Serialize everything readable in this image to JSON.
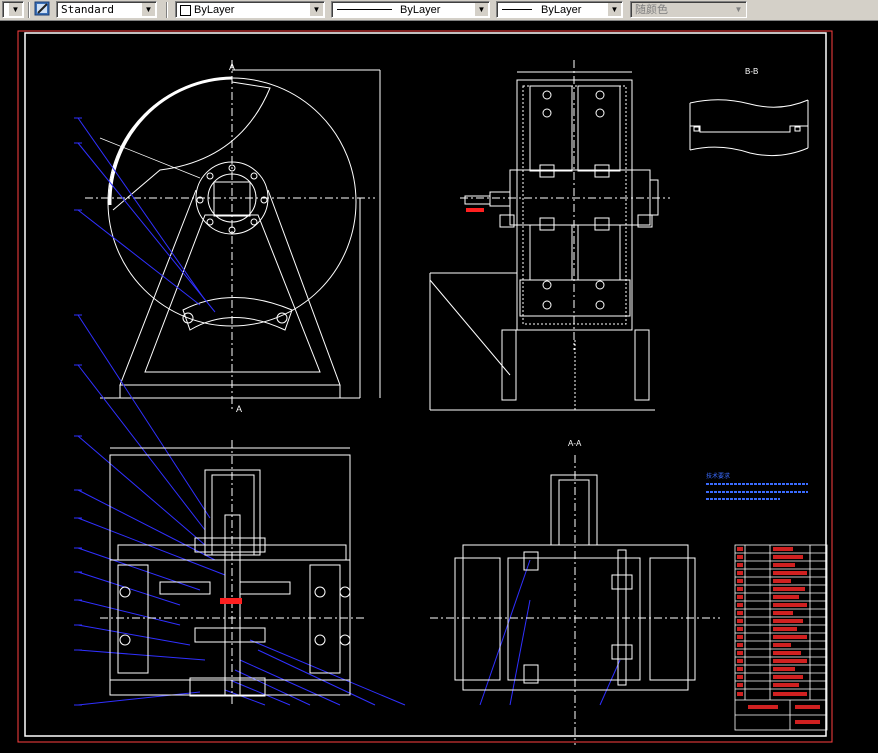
{
  "toolbar": {
    "text_style": "Standard",
    "layer_color": "ByLayer",
    "linetype": "ByLayer",
    "lineweight": "ByLayer",
    "plot_style": "随颜色"
  },
  "drawing": {
    "section_bb": "B-B",
    "section_aa": "A-A",
    "label_a": "A",
    "notes_title": "技术要求"
  }
}
